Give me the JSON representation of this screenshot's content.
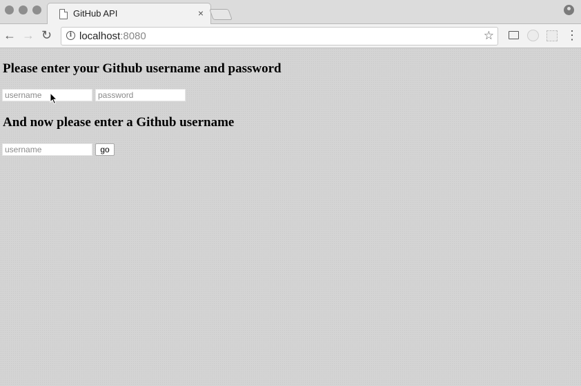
{
  "browser": {
    "tab": {
      "title": "GitHub API",
      "close_glyph": "×"
    },
    "address": {
      "host": "localhost",
      "port": ":8080"
    },
    "nav": {
      "back_glyph": "←",
      "forward_glyph": "→",
      "reload_glyph": "↻"
    },
    "star_glyph": "☆",
    "menu_glyph": "⋮",
    "info_glyph": "i"
  },
  "page": {
    "login_heading": "Please enter your Github username and password",
    "login_username_placeholder": "username",
    "login_password_placeholder": "password",
    "search_heading": "And now please enter a Github username",
    "search_username_placeholder": "username",
    "go_label": "go"
  },
  "icons": [
    "document-icon",
    "close-icon",
    "new-tab-icon",
    "profile-icon",
    "back-icon",
    "forward-icon",
    "reload-icon",
    "info-icon",
    "star-icon",
    "cast-icon",
    "extension-icon",
    "menu-icon",
    "mouse-cursor-icon"
  ]
}
